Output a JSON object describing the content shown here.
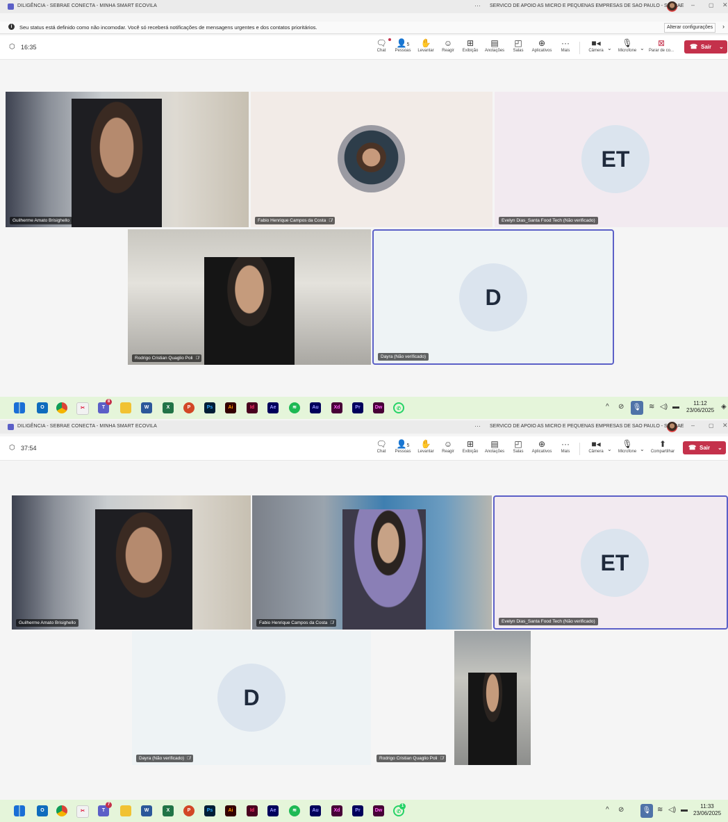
{
  "screen1": {
    "window_title": "DILIGÊNCIA - SEBRAE CONECTA - MINHA SMART ECOVILA",
    "org_name": "SERVICO DE APOIO AS MICRO E PEQUENAS EMPRESAS DE SAO PAULO - SEBRAE",
    "notice_text": "Seu status está definido como não incomodar. Você só receberá notificações de mensagens urgentes e dos contatos prioritários.",
    "notice_button": "Alterar configurações",
    "timer": "16:35",
    "toolbar": {
      "chat": "Chat",
      "people": "Pessoas",
      "people_count": "5",
      "raise": "Levantar",
      "react": "Reagir",
      "view": "Exibição",
      "notes": "Anotações",
      "rooms": "Salas",
      "apps": "Aplicativos",
      "more": "Mais",
      "camera": "Câmera",
      "mic": "Microfone",
      "share": "Parar de co...",
      "leave": "Sair"
    },
    "tiles": [
      {
        "name": "Guilherme Amato Brisighello"
      },
      {
        "name": "Fabio Henrique Campos da Costa"
      },
      {
        "name": "Evelyn Dias_Santa Food Tech (Não verificado)",
        "initials": "ET"
      },
      {
        "name": "Rodrigo Cristian Quaglio Poli"
      },
      {
        "name": "Dayra (Não verificado)",
        "initials": "D"
      }
    ],
    "clock_time": "11:12",
    "clock_date": "23/06/2025"
  },
  "screen2": {
    "window_title": "DILIGÊNCIA - SEBRAE CONECTA - MINHA SMART ECOVILA",
    "org_name": "SERVICO DE APOIO AS MICRO E PEQUENAS EMPRESAS DE SAO PAULO - SEBRAE",
    "timer": "37:54",
    "toolbar": {
      "chat": "Chat",
      "people": "Pessoas",
      "people_count": "5",
      "raise": "Levantar",
      "react": "Reagir",
      "view": "Exibição",
      "notes": "Anotações",
      "rooms": "Salas",
      "apps": "Aplicativos",
      "more": "Mais",
      "camera": "Câmera",
      "mic": "Microfone",
      "share": "Compartilhar",
      "leave": "Sair"
    },
    "tiles": [
      {
        "name": "Guilherme Amato Brisighello"
      },
      {
        "name": "Fabio Henrique Campos da Costa"
      },
      {
        "name": "Evelyn Dias_Santa Food Tech (Não verificado)",
        "initials": "ET"
      },
      {
        "name": "Dayra (Não verificado)",
        "initials": "D"
      },
      {
        "name": "Rodrigo Cristian Quaglio Poli"
      }
    ],
    "clock_time": "11:33",
    "clock_date": "23/06/2025"
  },
  "taskbar_apps": [
    {
      "icon": "windows-start-icon",
      "label": ""
    },
    {
      "icon": "outlook-icon",
      "label": "O"
    },
    {
      "icon": "chrome-icon",
      "label": ""
    },
    {
      "icon": "snipping-tool-icon",
      "label": ""
    },
    {
      "icon": "teams-icon",
      "label": "T"
    },
    {
      "icon": "file-explorer-icon",
      "label": ""
    },
    {
      "icon": "word-icon",
      "label": "W"
    },
    {
      "icon": "excel-icon",
      "label": "X"
    },
    {
      "icon": "powerpoint-icon",
      "label": "P"
    },
    {
      "icon": "photoshop-icon",
      "label": "Ps"
    },
    {
      "icon": "illustrator-icon",
      "label": "Ai"
    },
    {
      "icon": "indesign-icon",
      "label": "Id"
    },
    {
      "icon": "after-effects-icon",
      "label": "Ae"
    },
    {
      "icon": "spotify-icon",
      "label": ""
    },
    {
      "icon": "audition-icon",
      "label": "Au"
    },
    {
      "icon": "xd-icon",
      "label": "Xd"
    },
    {
      "icon": "premiere-icon",
      "label": "Pr"
    },
    {
      "icon": "dreamweaver-icon",
      "label": "Dw"
    },
    {
      "icon": "whatsapp-icon",
      "label": ""
    }
  ],
  "taskbar_badges": {
    "teams_s1": "8",
    "teams_s2": "7",
    "whatsapp_s2": "1"
  },
  "colors": {
    "accent": "#5b5fc7",
    "leave": "#c4314b",
    "taskbar": "#e5f5da"
  }
}
